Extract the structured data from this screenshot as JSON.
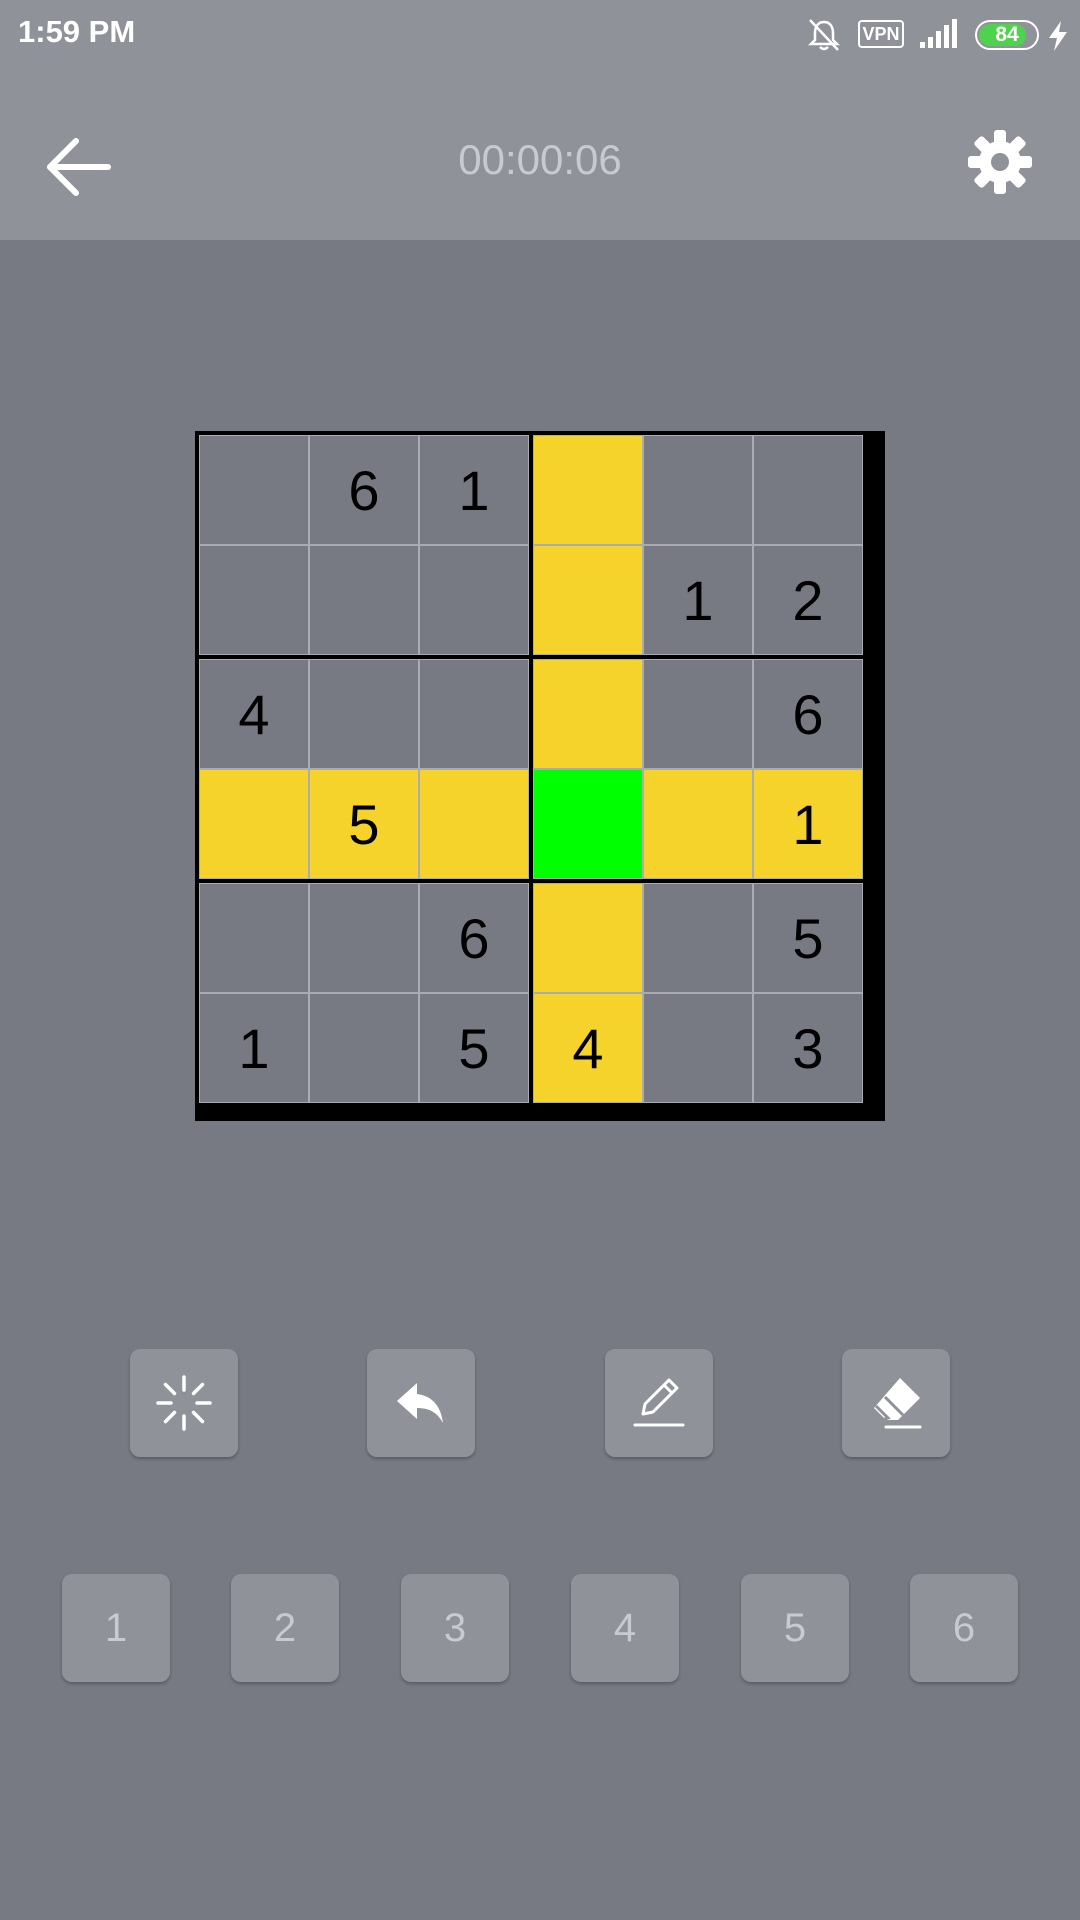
{
  "status_bar": {
    "time": "1:59 PM",
    "vpn_label": "VPN",
    "battery_level": "84",
    "battery_color": "#4fd34f"
  },
  "app_bar": {
    "timer": "00:00:06",
    "back_icon": "arrow-left-icon",
    "settings_icon": "gear-icon"
  },
  "board": {
    "size": 6,
    "selected": [
      3,
      3
    ],
    "highlight_color": "#f6d32a",
    "selected_color": "#00ff00",
    "rows": [
      [
        "",
        "6",
        "1",
        "",
        "",
        ""
      ],
      [
        "",
        "",
        "",
        "",
        "1",
        "2"
      ],
      [
        "4",
        "",
        "",
        "",
        "",
        "6"
      ],
      [
        "",
        "5",
        "",
        "",
        "",
        "1"
      ],
      [
        "",
        "",
        "6",
        "",
        "",
        "5"
      ],
      [
        "1",
        "",
        "5",
        "4",
        "",
        "3"
      ]
    ]
  },
  "tools": [
    {
      "name": "hint-button",
      "icon": "sparkle-icon"
    },
    {
      "name": "undo-button",
      "icon": "undo-icon"
    },
    {
      "name": "notes-button",
      "icon": "pencil-icon"
    },
    {
      "name": "erase-button",
      "icon": "eraser-icon"
    }
  ],
  "number_pad": [
    "1",
    "2",
    "3",
    "4",
    "5",
    "6"
  ]
}
